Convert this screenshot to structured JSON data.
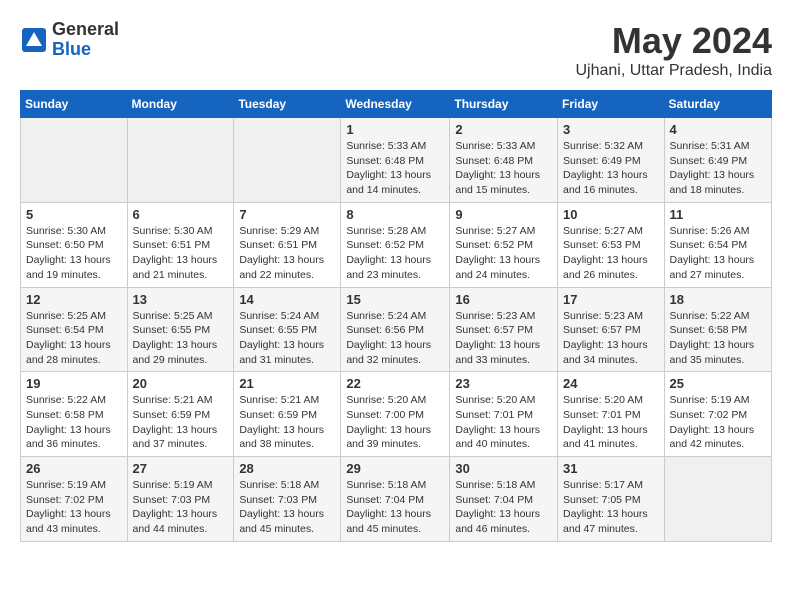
{
  "header": {
    "logo_general": "General",
    "logo_blue": "Blue",
    "title": "May 2024",
    "location": "Ujhani, Uttar Pradesh, India"
  },
  "calendar": {
    "days_of_week": [
      "Sunday",
      "Monday",
      "Tuesday",
      "Wednesday",
      "Thursday",
      "Friday",
      "Saturday"
    ],
    "weeks": [
      [
        {
          "day": "",
          "info": ""
        },
        {
          "day": "",
          "info": ""
        },
        {
          "day": "",
          "info": ""
        },
        {
          "day": "1",
          "info": "Sunrise: 5:33 AM\nSunset: 6:48 PM\nDaylight: 13 hours\nand 14 minutes."
        },
        {
          "day": "2",
          "info": "Sunrise: 5:33 AM\nSunset: 6:48 PM\nDaylight: 13 hours\nand 15 minutes."
        },
        {
          "day": "3",
          "info": "Sunrise: 5:32 AM\nSunset: 6:49 PM\nDaylight: 13 hours\nand 16 minutes."
        },
        {
          "day": "4",
          "info": "Sunrise: 5:31 AM\nSunset: 6:49 PM\nDaylight: 13 hours\nand 18 minutes."
        }
      ],
      [
        {
          "day": "5",
          "info": "Sunrise: 5:30 AM\nSunset: 6:50 PM\nDaylight: 13 hours\nand 19 minutes."
        },
        {
          "day": "6",
          "info": "Sunrise: 5:30 AM\nSunset: 6:51 PM\nDaylight: 13 hours\nand 21 minutes."
        },
        {
          "day": "7",
          "info": "Sunrise: 5:29 AM\nSunset: 6:51 PM\nDaylight: 13 hours\nand 22 minutes."
        },
        {
          "day": "8",
          "info": "Sunrise: 5:28 AM\nSunset: 6:52 PM\nDaylight: 13 hours\nand 23 minutes."
        },
        {
          "day": "9",
          "info": "Sunrise: 5:27 AM\nSunset: 6:52 PM\nDaylight: 13 hours\nand 24 minutes."
        },
        {
          "day": "10",
          "info": "Sunrise: 5:27 AM\nSunset: 6:53 PM\nDaylight: 13 hours\nand 26 minutes."
        },
        {
          "day": "11",
          "info": "Sunrise: 5:26 AM\nSunset: 6:54 PM\nDaylight: 13 hours\nand 27 minutes."
        }
      ],
      [
        {
          "day": "12",
          "info": "Sunrise: 5:25 AM\nSunset: 6:54 PM\nDaylight: 13 hours\nand 28 minutes."
        },
        {
          "day": "13",
          "info": "Sunrise: 5:25 AM\nSunset: 6:55 PM\nDaylight: 13 hours\nand 29 minutes."
        },
        {
          "day": "14",
          "info": "Sunrise: 5:24 AM\nSunset: 6:55 PM\nDaylight: 13 hours\nand 31 minutes."
        },
        {
          "day": "15",
          "info": "Sunrise: 5:24 AM\nSunset: 6:56 PM\nDaylight: 13 hours\nand 32 minutes."
        },
        {
          "day": "16",
          "info": "Sunrise: 5:23 AM\nSunset: 6:57 PM\nDaylight: 13 hours\nand 33 minutes."
        },
        {
          "day": "17",
          "info": "Sunrise: 5:23 AM\nSunset: 6:57 PM\nDaylight: 13 hours\nand 34 minutes."
        },
        {
          "day": "18",
          "info": "Sunrise: 5:22 AM\nSunset: 6:58 PM\nDaylight: 13 hours\nand 35 minutes."
        }
      ],
      [
        {
          "day": "19",
          "info": "Sunrise: 5:22 AM\nSunset: 6:58 PM\nDaylight: 13 hours\nand 36 minutes."
        },
        {
          "day": "20",
          "info": "Sunrise: 5:21 AM\nSunset: 6:59 PM\nDaylight: 13 hours\nand 37 minutes."
        },
        {
          "day": "21",
          "info": "Sunrise: 5:21 AM\nSunset: 6:59 PM\nDaylight: 13 hours\nand 38 minutes."
        },
        {
          "day": "22",
          "info": "Sunrise: 5:20 AM\nSunset: 7:00 PM\nDaylight: 13 hours\nand 39 minutes."
        },
        {
          "day": "23",
          "info": "Sunrise: 5:20 AM\nSunset: 7:01 PM\nDaylight: 13 hours\nand 40 minutes."
        },
        {
          "day": "24",
          "info": "Sunrise: 5:20 AM\nSunset: 7:01 PM\nDaylight: 13 hours\nand 41 minutes."
        },
        {
          "day": "25",
          "info": "Sunrise: 5:19 AM\nSunset: 7:02 PM\nDaylight: 13 hours\nand 42 minutes."
        }
      ],
      [
        {
          "day": "26",
          "info": "Sunrise: 5:19 AM\nSunset: 7:02 PM\nDaylight: 13 hours\nand 43 minutes."
        },
        {
          "day": "27",
          "info": "Sunrise: 5:19 AM\nSunset: 7:03 PM\nDaylight: 13 hours\nand 44 minutes."
        },
        {
          "day": "28",
          "info": "Sunrise: 5:18 AM\nSunset: 7:03 PM\nDaylight: 13 hours\nand 45 minutes."
        },
        {
          "day": "29",
          "info": "Sunrise: 5:18 AM\nSunset: 7:04 PM\nDaylight: 13 hours\nand 45 minutes."
        },
        {
          "day": "30",
          "info": "Sunrise: 5:18 AM\nSunset: 7:04 PM\nDaylight: 13 hours\nand 46 minutes."
        },
        {
          "day": "31",
          "info": "Sunrise: 5:17 AM\nSunset: 7:05 PM\nDaylight: 13 hours\nand 47 minutes."
        },
        {
          "day": "",
          "info": ""
        }
      ]
    ]
  }
}
